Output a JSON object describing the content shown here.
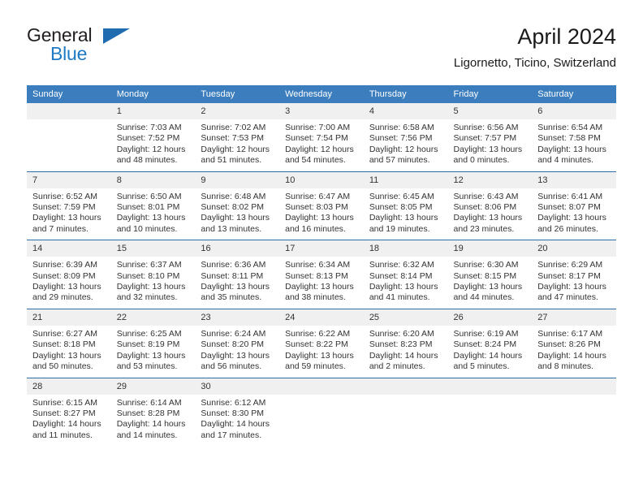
{
  "brand": {
    "name_part1": "General",
    "name_part2": "Blue",
    "logo_icon": "triangle-logo-icon"
  },
  "header": {
    "title": "April 2024",
    "subtitle": "Ligornetto, Ticino, Switzerland"
  },
  "colors": {
    "header_blue": "#3b7dbd",
    "row_divider_blue": "#2e6da4",
    "daynum_band": "#f0f0f0",
    "brand_blue": "#1f7ac4",
    "text": "#333333"
  },
  "weekdays": [
    "Sunday",
    "Monday",
    "Tuesday",
    "Wednesday",
    "Thursday",
    "Friday",
    "Saturday"
  ],
  "weeks": [
    [
      {
        "day": "",
        "lines": []
      },
      {
        "day": "1",
        "lines": [
          "Sunrise: 7:03 AM",
          "Sunset: 7:52 PM",
          "Daylight: 12 hours",
          "and 48 minutes."
        ]
      },
      {
        "day": "2",
        "lines": [
          "Sunrise: 7:02 AM",
          "Sunset: 7:53 PM",
          "Daylight: 12 hours",
          "and 51 minutes."
        ]
      },
      {
        "day": "3",
        "lines": [
          "Sunrise: 7:00 AM",
          "Sunset: 7:54 PM",
          "Daylight: 12 hours",
          "and 54 minutes."
        ]
      },
      {
        "day": "4",
        "lines": [
          "Sunrise: 6:58 AM",
          "Sunset: 7:56 PM",
          "Daylight: 12 hours",
          "and 57 minutes."
        ]
      },
      {
        "day": "5",
        "lines": [
          "Sunrise: 6:56 AM",
          "Sunset: 7:57 PM",
          "Daylight: 13 hours",
          "and 0 minutes."
        ]
      },
      {
        "day": "6",
        "lines": [
          "Sunrise: 6:54 AM",
          "Sunset: 7:58 PM",
          "Daylight: 13 hours",
          "and 4 minutes."
        ]
      }
    ],
    [
      {
        "day": "7",
        "lines": [
          "Sunrise: 6:52 AM",
          "Sunset: 7:59 PM",
          "Daylight: 13 hours",
          "and 7 minutes."
        ]
      },
      {
        "day": "8",
        "lines": [
          "Sunrise: 6:50 AM",
          "Sunset: 8:01 PM",
          "Daylight: 13 hours",
          "and 10 minutes."
        ]
      },
      {
        "day": "9",
        "lines": [
          "Sunrise: 6:48 AM",
          "Sunset: 8:02 PM",
          "Daylight: 13 hours",
          "and 13 minutes."
        ]
      },
      {
        "day": "10",
        "lines": [
          "Sunrise: 6:47 AM",
          "Sunset: 8:03 PM",
          "Daylight: 13 hours",
          "and 16 minutes."
        ]
      },
      {
        "day": "11",
        "lines": [
          "Sunrise: 6:45 AM",
          "Sunset: 8:05 PM",
          "Daylight: 13 hours",
          "and 19 minutes."
        ]
      },
      {
        "day": "12",
        "lines": [
          "Sunrise: 6:43 AM",
          "Sunset: 8:06 PM",
          "Daylight: 13 hours",
          "and 23 minutes."
        ]
      },
      {
        "day": "13",
        "lines": [
          "Sunrise: 6:41 AM",
          "Sunset: 8:07 PM",
          "Daylight: 13 hours",
          "and 26 minutes."
        ]
      }
    ],
    [
      {
        "day": "14",
        "lines": [
          "Sunrise: 6:39 AM",
          "Sunset: 8:09 PM",
          "Daylight: 13 hours",
          "and 29 minutes."
        ]
      },
      {
        "day": "15",
        "lines": [
          "Sunrise: 6:37 AM",
          "Sunset: 8:10 PM",
          "Daylight: 13 hours",
          "and 32 minutes."
        ]
      },
      {
        "day": "16",
        "lines": [
          "Sunrise: 6:36 AM",
          "Sunset: 8:11 PM",
          "Daylight: 13 hours",
          "and 35 minutes."
        ]
      },
      {
        "day": "17",
        "lines": [
          "Sunrise: 6:34 AM",
          "Sunset: 8:13 PM",
          "Daylight: 13 hours",
          "and 38 minutes."
        ]
      },
      {
        "day": "18",
        "lines": [
          "Sunrise: 6:32 AM",
          "Sunset: 8:14 PM",
          "Daylight: 13 hours",
          "and 41 minutes."
        ]
      },
      {
        "day": "19",
        "lines": [
          "Sunrise: 6:30 AM",
          "Sunset: 8:15 PM",
          "Daylight: 13 hours",
          "and 44 minutes."
        ]
      },
      {
        "day": "20",
        "lines": [
          "Sunrise: 6:29 AM",
          "Sunset: 8:17 PM",
          "Daylight: 13 hours",
          "and 47 minutes."
        ]
      }
    ],
    [
      {
        "day": "21",
        "lines": [
          "Sunrise: 6:27 AM",
          "Sunset: 8:18 PM",
          "Daylight: 13 hours",
          "and 50 minutes."
        ]
      },
      {
        "day": "22",
        "lines": [
          "Sunrise: 6:25 AM",
          "Sunset: 8:19 PM",
          "Daylight: 13 hours",
          "and 53 minutes."
        ]
      },
      {
        "day": "23",
        "lines": [
          "Sunrise: 6:24 AM",
          "Sunset: 8:20 PM",
          "Daylight: 13 hours",
          "and 56 minutes."
        ]
      },
      {
        "day": "24",
        "lines": [
          "Sunrise: 6:22 AM",
          "Sunset: 8:22 PM",
          "Daylight: 13 hours",
          "and 59 minutes."
        ]
      },
      {
        "day": "25",
        "lines": [
          "Sunrise: 6:20 AM",
          "Sunset: 8:23 PM",
          "Daylight: 14 hours",
          "and 2 minutes."
        ]
      },
      {
        "day": "26",
        "lines": [
          "Sunrise: 6:19 AM",
          "Sunset: 8:24 PM",
          "Daylight: 14 hours",
          "and 5 minutes."
        ]
      },
      {
        "day": "27",
        "lines": [
          "Sunrise: 6:17 AM",
          "Sunset: 8:26 PM",
          "Daylight: 14 hours",
          "and 8 minutes."
        ]
      }
    ],
    [
      {
        "day": "28",
        "lines": [
          "Sunrise: 6:15 AM",
          "Sunset: 8:27 PM",
          "Daylight: 14 hours",
          "and 11 minutes."
        ]
      },
      {
        "day": "29",
        "lines": [
          "Sunrise: 6:14 AM",
          "Sunset: 8:28 PM",
          "Daylight: 14 hours",
          "and 14 minutes."
        ]
      },
      {
        "day": "30",
        "lines": [
          "Sunrise: 6:12 AM",
          "Sunset: 8:30 PM",
          "Daylight: 14 hours",
          "and 17 minutes."
        ]
      },
      {
        "day": "",
        "lines": []
      },
      {
        "day": "",
        "lines": []
      },
      {
        "day": "",
        "lines": []
      },
      {
        "day": "",
        "lines": []
      }
    ]
  ]
}
